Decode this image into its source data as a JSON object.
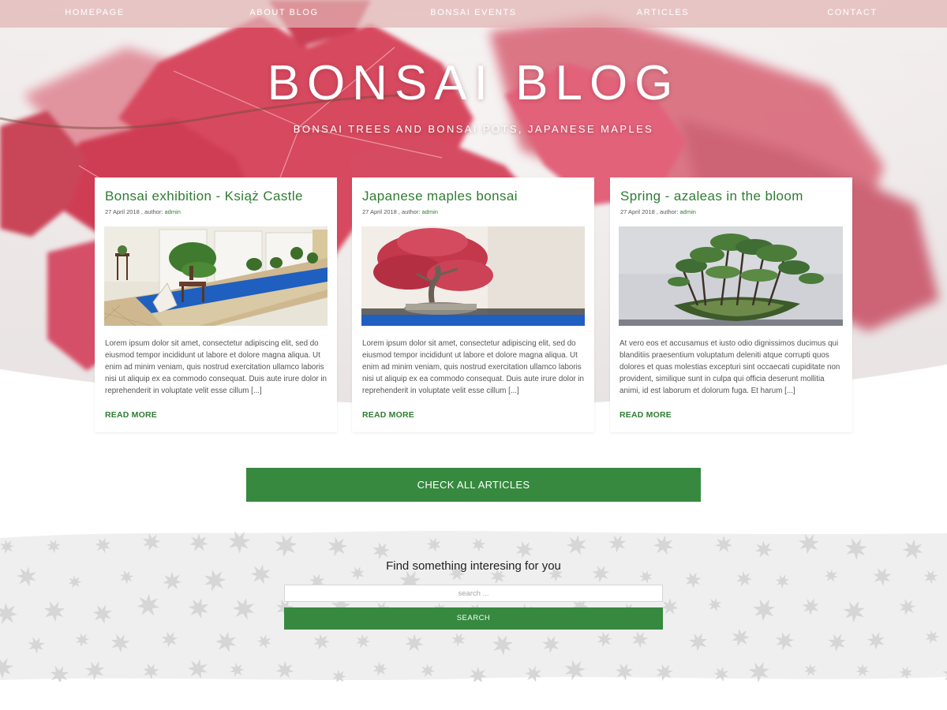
{
  "nav": {
    "items": [
      "HOMEPAGE",
      "ABOUT BLOG",
      "BONSAI EVENTS",
      "ARTICLES",
      "CONTACT"
    ]
  },
  "hero": {
    "title": "BONSAI BLOG",
    "tagline": "BONSAI TREES AND BONSAI POTS, JAPANESE MAPLES"
  },
  "posts": [
    {
      "title": "Bonsai exhibition - Książ Castle",
      "date": "27 April 2018",
      "author_prefix": ", author:",
      "author": "admin",
      "excerpt": "Lorem ipsum dolor sit amet, consectetur adipiscing elit, sed do eiusmod tempor incididunt ut labore et dolore magna aliqua. Ut enim ad minim veniam, quis nostrud exercitation ullamco laboris nisi ut aliquip ex ea commodo consequat. Duis aute irure dolor in reprehenderit in voluptate velit esse cillum [...]",
      "read_more": "READ MORE"
    },
    {
      "title": "Japanese maples bonsai",
      "date": "27 April 2018",
      "author_prefix": ", author:",
      "author": "admin",
      "excerpt": "Lorem ipsum dolor sit amet, consectetur adipiscing elit, sed do eiusmod tempor incididunt ut labore et dolore magna aliqua. Ut enim ad minim veniam, quis nostrud exercitation ullamco laboris nisi ut aliquip ex ea commodo consequat. Duis aute irure dolor in reprehenderit in voluptate velit esse cillum [...]",
      "read_more": "READ MORE"
    },
    {
      "title": "Spring - azaleas in the bloom",
      "date": "27 April 2018",
      "author_prefix": ", author:",
      "author": "admin",
      "excerpt": "At vero eos et accusamus et iusto odio dignissimos ducimus qui blanditiis praesentium voluptatum deleniti atque corrupti quos dolores et quas molestias excepturi sint occaecati cupiditate non provident, similique sunt in culpa qui officia deserunt mollitia animi, id est laborum et dolorum fuga. Et harum [...]",
      "read_more": "READ MORE"
    }
  ],
  "check_all": {
    "label": "CHECK ALL ARTICLES"
  },
  "search": {
    "heading": "Find something interesing for you",
    "placeholder": "search ...",
    "button_label": "SEARCH"
  },
  "colors": {
    "accent_green": "#36893f",
    "title_green": "#2e7d32",
    "maple_red": "#d7485f",
    "nav_pink": "#e2b4b4"
  }
}
